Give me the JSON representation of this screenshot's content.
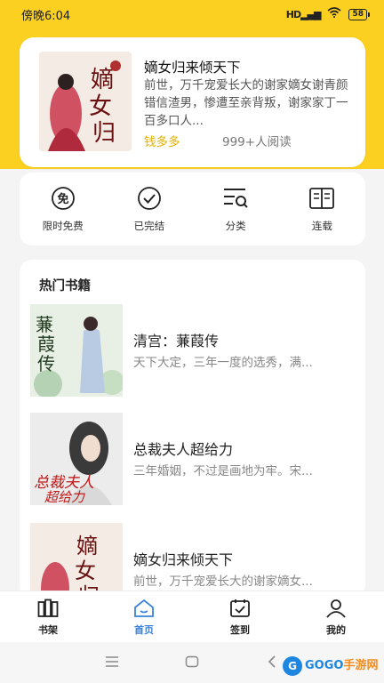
{
  "status_bar": {
    "time": "傍晚6:04",
    "signal": "HD",
    "battery": "58"
  },
  "banner": {
    "title": "嫡女归来倾天下",
    "description": "前世，万千宠爱长大的谢家嫡女谢青颜错信渣男，惨遭至亲背叛，谢家家丁一百多口人...",
    "author": "钱多多",
    "readers": "999+人阅读",
    "cover_text": "嫡女归来"
  },
  "categories": [
    {
      "label": "限时免费",
      "icon": "free-icon"
    },
    {
      "label": "已完结",
      "icon": "check-circle-icon"
    },
    {
      "label": "分类",
      "icon": "category-icon"
    },
    {
      "label": "连载",
      "icon": "book-open-icon"
    }
  ],
  "hot_books": {
    "title": "热门书籍",
    "items": [
      {
        "title": "清宫：蒹葭传",
        "description": "天下大定，三年一度的选秀，满...",
        "cover_text": "蒹葭传"
      },
      {
        "title": "总裁夫人超给力",
        "description": "三年婚姻，不过是画地为牢。宋...",
        "cover_text": "总裁夫人超给力"
      },
      {
        "title": "嫡女归来倾天下",
        "description": "前世，万千宠爱长大的谢家嫡女...",
        "cover_text": "嫡女归来"
      }
    ]
  },
  "bottom_nav": [
    {
      "label": "书架",
      "icon": "bookshelf-icon",
      "active": false
    },
    {
      "label": "首页",
      "icon": "home-icon",
      "active": true
    },
    {
      "label": "签到",
      "icon": "checkin-icon",
      "active": false
    },
    {
      "label": "我的",
      "icon": "profile-icon",
      "active": false
    }
  ],
  "watermark": {
    "brand": "GOGO",
    "brand_suffix": "手游网",
    "site": "GOGO手游网"
  },
  "colors": {
    "accent": "#fbd020",
    "active_nav": "#3a83d8",
    "author": "#e5b000"
  }
}
